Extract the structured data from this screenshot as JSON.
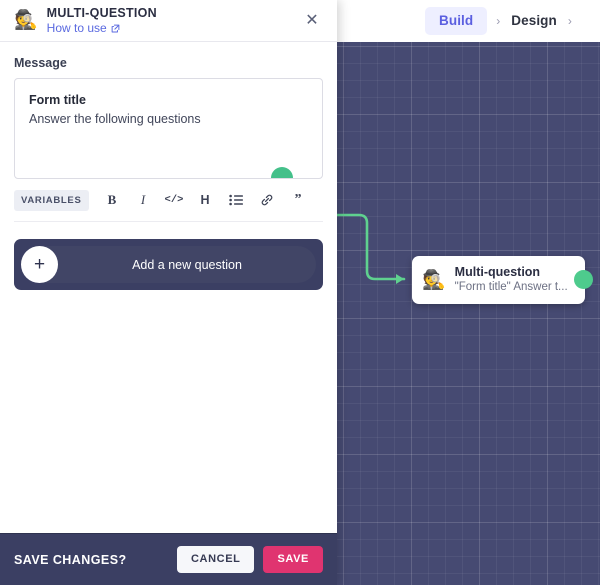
{
  "topnav": {
    "build_label": "Build",
    "design_label": "Design",
    "separator": "›",
    "active": "Build",
    "active_color": "#5b5fe0",
    "active_bg": "#eeefff"
  },
  "panel": {
    "icon": "detective-emoji",
    "icon_glyph": "🕵️",
    "title": "MULTI-QUESTION",
    "help_link": "How to use",
    "help_link_icon": "external-link-icon",
    "close_icon": "✕",
    "message": {
      "label": "Message",
      "title_text": "Form title",
      "body_text": "Answer the following questions",
      "badge_color": "#44c08a"
    },
    "toolbar": {
      "variables_label": "VARIABLES",
      "items": [
        {
          "name": "bold-icon",
          "glyph": "B"
        },
        {
          "name": "italic-icon",
          "glyph": "I"
        },
        {
          "name": "code-icon",
          "glyph": "</>"
        },
        {
          "name": "heading-icon",
          "glyph": "H"
        },
        {
          "name": "bullet-list-icon",
          "glyph": "list"
        },
        {
          "name": "link-icon",
          "glyph": "link"
        },
        {
          "name": "quote-icon",
          "glyph": "”"
        }
      ]
    },
    "add_question": {
      "plus_glyph": "+",
      "label": "Add a new question",
      "bg_color": "#3b3f63"
    },
    "save_bar": {
      "prompt": "SAVE CHANGES?",
      "cancel_label": "CANCEL",
      "save_label": "SAVE",
      "save_color": "#e03470",
      "bar_color": "#3b3f63"
    }
  },
  "canvas": {
    "bg_color": "#464a72",
    "connector_color": "#5fd18f",
    "node": {
      "icon": "detective-emoji",
      "icon_glyph": "🕵️",
      "title": "Multi-question",
      "subtitle": "\"Form title\" Answer t...",
      "port_color": "#4ecb8d"
    }
  }
}
